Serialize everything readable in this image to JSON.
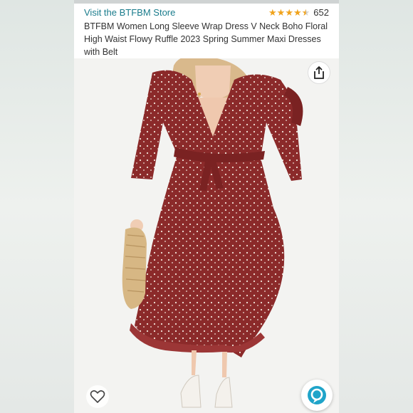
{
  "store": {
    "link_label": "Visit the BTFBM Store"
  },
  "rating": {
    "stars": 4.5,
    "count": "652"
  },
  "product": {
    "title": "BTFBM Women Long Sleeve Wrap Dress V Neck Boho Floral High Waist Flowy Ruffle 2023 Spring Summer Maxi Dresses with Belt"
  },
  "icons": {
    "share": "share-icon",
    "heart": "heart-icon",
    "alexa": "alexa-icon"
  },
  "colors": {
    "link": "#1a7c8c",
    "star": "#f0a31c",
    "dress": "#8b2a2a",
    "alexa": "#1fa4c9"
  }
}
